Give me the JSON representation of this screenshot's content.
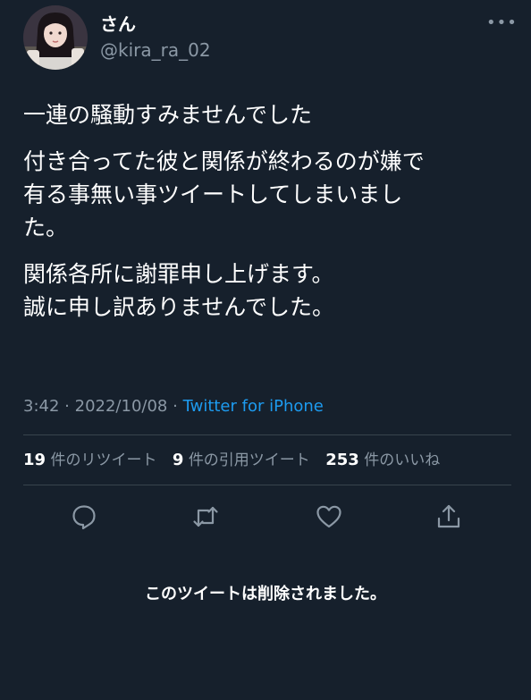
{
  "user": {
    "display_name": "さん",
    "handle": "@kira_ra_02",
    "avatar_icon": "user-avatar-photo"
  },
  "header": {
    "more_icon": "more-dots-icon",
    "more_glyph": "•••"
  },
  "tweet": {
    "paragraphs": [
      "一連の騒動すみませんでした",
      "付き合ってた彼と関係が終わるのが嫌で\n有る事無い事ツイートしてしまいまし\nた。",
      "関係各所に謝罪申し上げます。\n誠に申し訳ありませんでした。"
    ],
    "time": "3:42",
    "separator": "·",
    "date": "2022/10/08",
    "source": "Twitter for iPhone"
  },
  "stats": {
    "retweets_count": "19",
    "retweets_label": "件のリツイート",
    "quotes_count": "9",
    "quotes_label": "件の引用ツイート",
    "likes_count": "253",
    "likes_label": "件のいいね"
  },
  "actions": {
    "reply_icon": "reply-icon",
    "retweet_icon": "retweet-icon",
    "like_icon": "like-icon",
    "share_icon": "share-icon"
  },
  "notice": {
    "deleted_text": "このツイートは削除されました。"
  },
  "colors": {
    "background": "#16202c",
    "text": "#ffffff",
    "secondary": "#8b98a5",
    "link": "#1d9bf0",
    "divider": "#38444d"
  }
}
